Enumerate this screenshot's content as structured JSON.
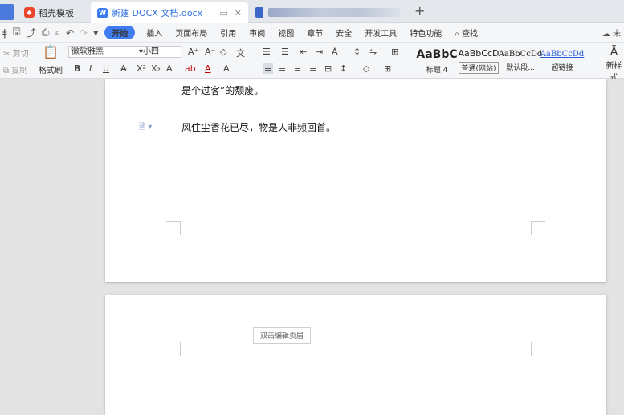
{
  "tabs": [
    {
      "label": "稻壳模板"
    },
    {
      "label": "新建 DOCX 文档.docx"
    },
    {
      "label": ""
    }
  ],
  "menu": {
    "items": [
      "插入",
      "页面布局",
      "引用",
      "审阅",
      "视图",
      "章节",
      "安全",
      "开发工具",
      "特色功能"
    ],
    "start": "开始",
    "search": "查找",
    "right": "未"
  },
  "ribbon": {
    "cut": "剪切",
    "copy": "复制",
    "format_painter": "格式刷",
    "font_name": "微软雅黑",
    "font_size": "小四",
    "new_style": "新样式"
  },
  "styles": [
    {
      "sample": "AaBbC",
      "name": "标题 4"
    },
    {
      "sample": "AaBbCcD",
      "name": "普通(网站)"
    },
    {
      "sample": "AaBbCcDd",
      "name": "默认段..."
    },
    {
      "sample": "AaBbCcDd",
      "name": "超链接"
    }
  ],
  "document": {
    "line1": "是个过客”的颓废。",
    "line2": "风住尘香花已尽，物是人非频回首。",
    "header_tip": "双击编辑页眉"
  },
  "colors": {
    "accent": "#3f7df0",
    "tabbar": "#e4e7ec",
    "ribbon": "#f5f6f8",
    "workspace": "#e3e3e3"
  }
}
